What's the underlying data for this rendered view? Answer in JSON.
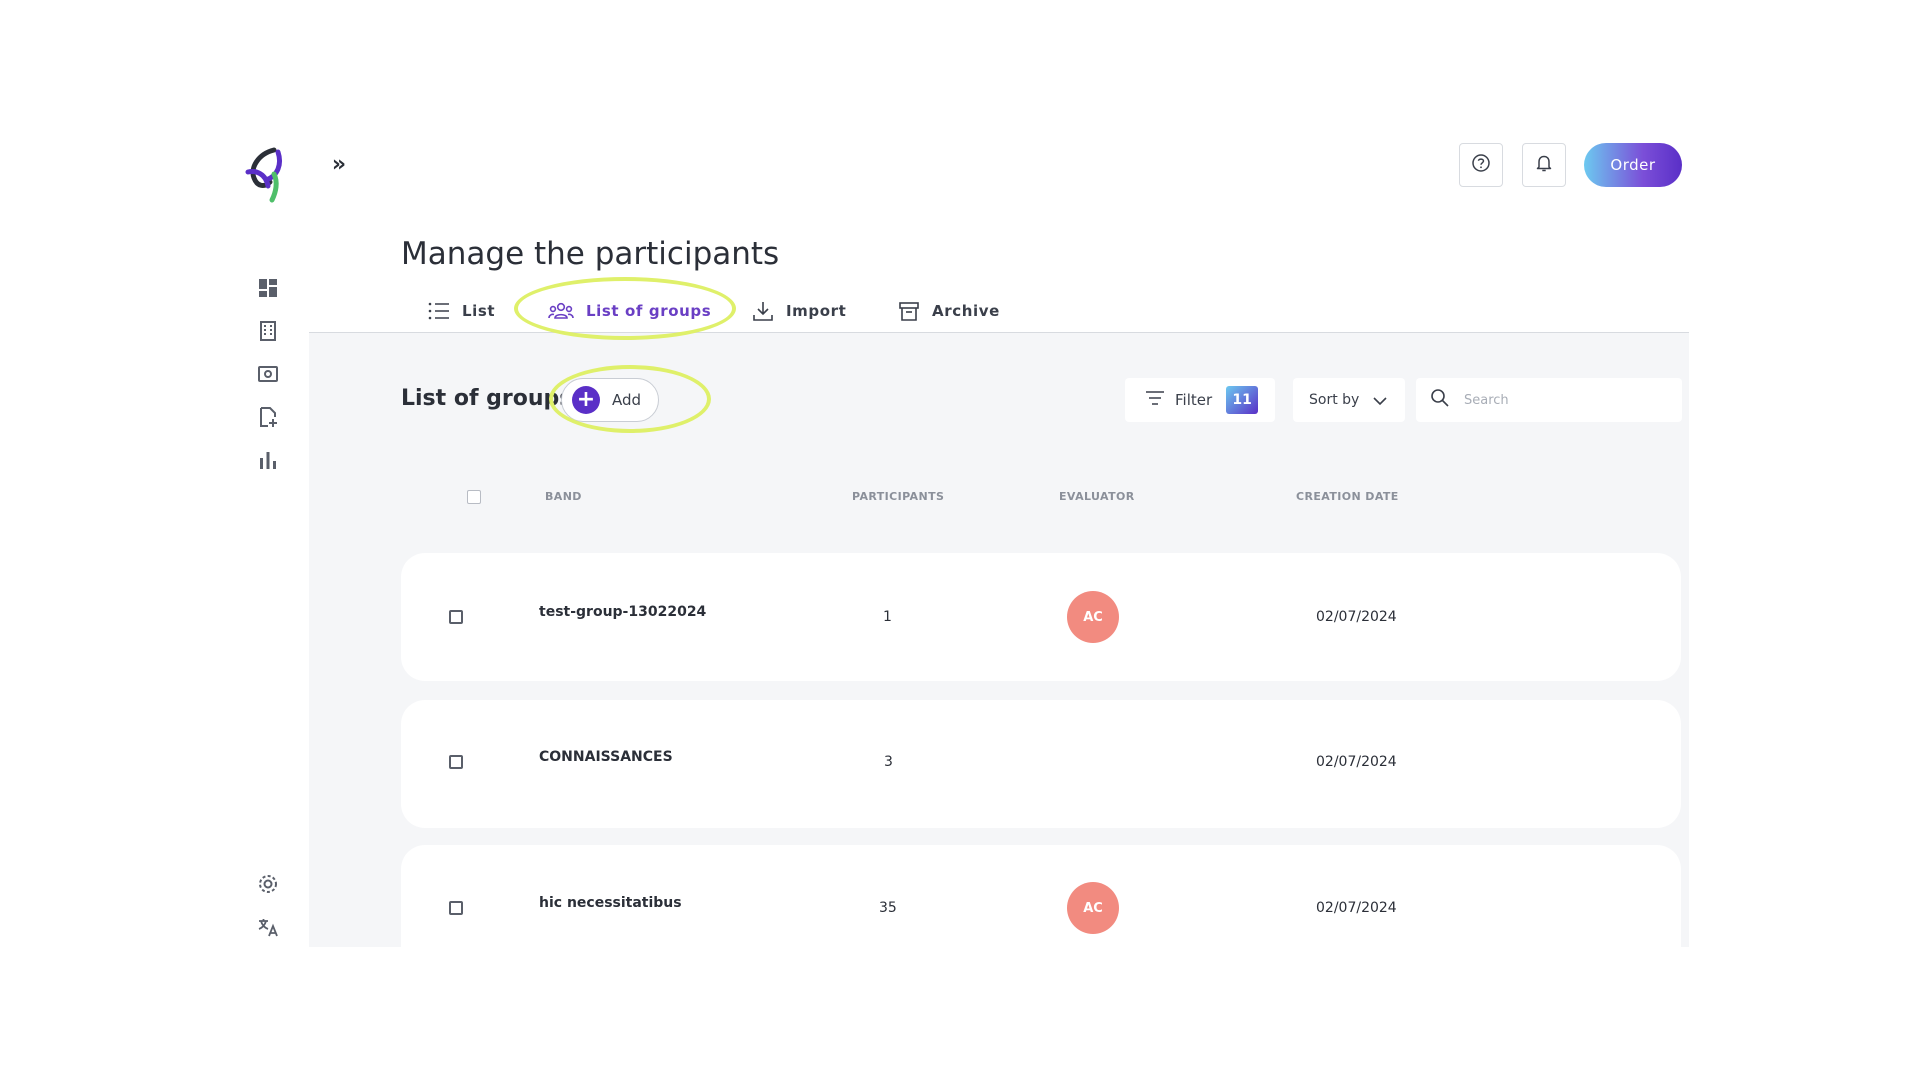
{
  "app": {
    "collapse_glyph": "»",
    "sidebar_icons": [
      "dashboard-icon",
      "building-icon",
      "screen-icon",
      "add-document-icon",
      "bar-chart-icon",
      "settings-icon",
      "translate-icon"
    ]
  },
  "header": {
    "help_icon": "question-circle-icon",
    "notification_icon": "bell-icon",
    "order_label": "Order"
  },
  "page": {
    "title": "Manage the participants"
  },
  "tabs": [
    {
      "label": "List",
      "icon": "list-icon",
      "active": false
    },
    {
      "label": "List of groups",
      "icon": "group-icon",
      "active": true
    },
    {
      "label": "Import",
      "icon": "download-icon",
      "active": false
    },
    {
      "label": "Archive",
      "icon": "archive-icon",
      "active": false
    }
  ],
  "toolbar": {
    "section_title": "List of groups",
    "add_label": "Add",
    "add_glyph": "+",
    "filter_label": "Filter",
    "filter_count": "11",
    "sort_label": "Sort by",
    "search_placeholder": "Search"
  },
  "table": {
    "columns": [
      "BAND",
      "PARTICIPANTS",
      "EVALUATOR",
      "CREATION DATE"
    ],
    "rows": [
      {
        "band": "test-group-13022024",
        "participants": "1",
        "evaluator": "AC",
        "creation_date": "02/07/2024"
      },
      {
        "band": "CONNAISSANCES",
        "participants": "3",
        "evaluator": "",
        "creation_date": "02/07/2024"
      },
      {
        "band": "hic necessitatibus",
        "participants": "35",
        "evaluator": "AC",
        "creation_date": "02/07/2024"
      }
    ]
  },
  "colors": {
    "accent": "#5a2fc7",
    "highlight": "#dff06a",
    "avatar": "#f28b80",
    "panel_bg": "#f5f6f8"
  }
}
